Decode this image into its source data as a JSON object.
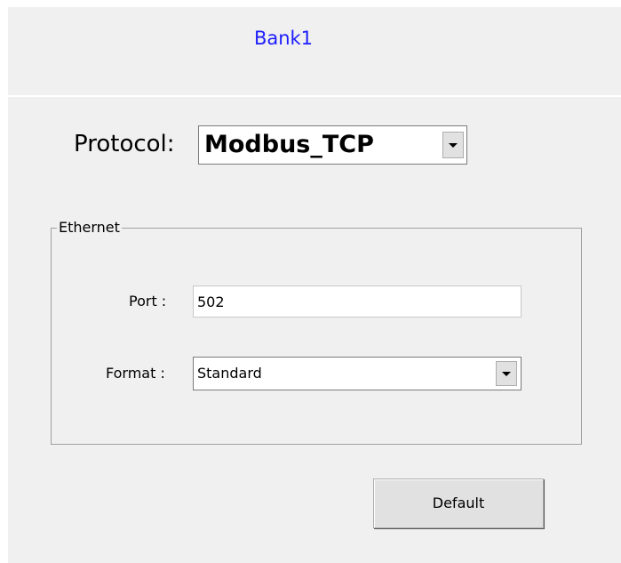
{
  "title": "Bank1",
  "protocol": {
    "label": "Protocol:",
    "value": "Modbus_TCP"
  },
  "ethernet": {
    "legend": "Ethernet",
    "port_label": "Port :",
    "port_value": "502",
    "format_label": "Format :",
    "format_value": "Standard"
  },
  "default_button": "Default",
  "icons": {
    "protocol_dropdown": "chevron-down-icon",
    "format_dropdown": "chevron-down-icon"
  },
  "colors": {
    "title": "#1d1dff",
    "background": "#f0f0f0"
  }
}
